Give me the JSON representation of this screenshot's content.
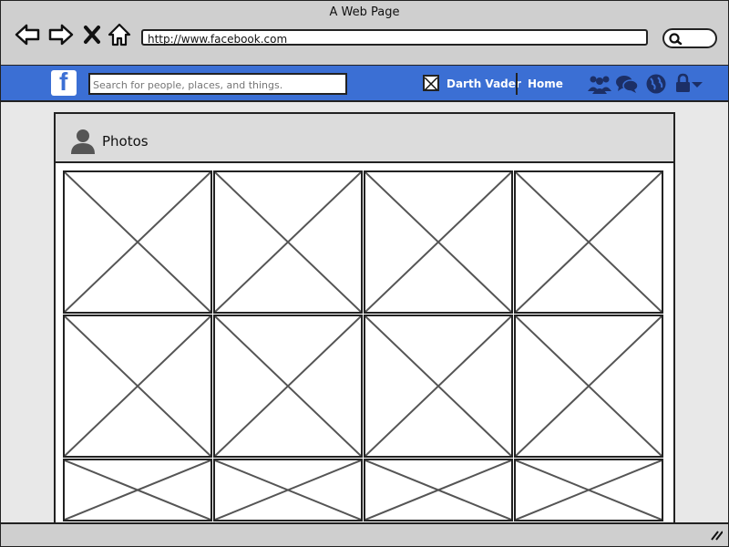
{
  "window": {
    "title": "A Web Page"
  },
  "browser": {
    "url": "http://www.facebook.com"
  },
  "facebook": {
    "logo": "f",
    "search_placeholder": "Search for people, places, and things.",
    "user_name": "Darth Vader",
    "home_label": "Home",
    "icons": [
      "friends-icon",
      "messages-icon",
      "globe-icon",
      "lock-icon"
    ],
    "brand_color": "#3b6fd4"
  },
  "panel": {
    "title": "Photos",
    "photos": [
      {
        "kind": "image-placeholder"
      },
      {
        "kind": "image-placeholder"
      },
      {
        "kind": "image-placeholder"
      },
      {
        "kind": "image-placeholder"
      },
      {
        "kind": "image-placeholder"
      },
      {
        "kind": "image-placeholder"
      },
      {
        "kind": "image-placeholder"
      },
      {
        "kind": "image-placeholder"
      },
      {
        "kind": "image-placeholder"
      },
      {
        "kind": "image-placeholder"
      },
      {
        "kind": "image-placeholder"
      },
      {
        "kind": "image-placeholder"
      }
    ]
  }
}
